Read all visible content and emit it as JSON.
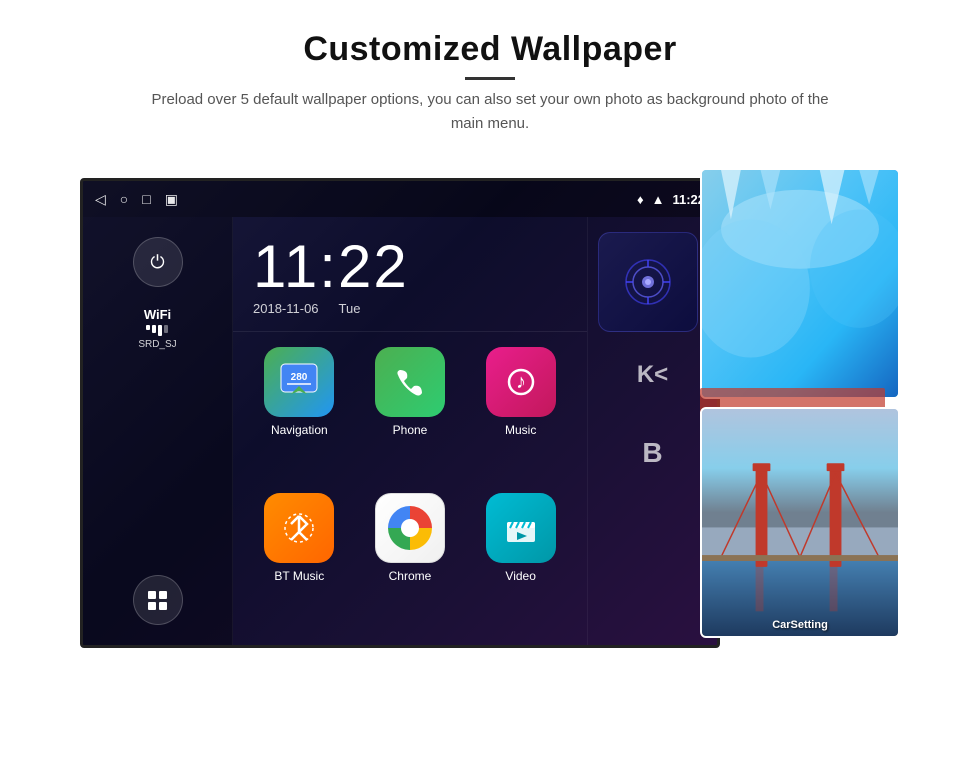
{
  "page": {
    "title": "Customized Wallpaper",
    "title_divider": true,
    "subtitle": "Preload over 5 default wallpaper options, you can also set your own photo as background photo of the main menu."
  },
  "status_bar": {
    "time": "11:22",
    "icons_left": [
      "back",
      "home",
      "recent",
      "screenshot"
    ],
    "icons_right": [
      "location",
      "wifi",
      "time"
    ]
  },
  "clock": {
    "time": "11:22",
    "date": "2018-11-06",
    "day": "Tue"
  },
  "wifi": {
    "label": "WiFi",
    "ssid": "SRD_SJ"
  },
  "apps": [
    {
      "id": "navigation",
      "label": "Navigation",
      "icon_class": "icon-navigation"
    },
    {
      "id": "phone",
      "label": "Phone",
      "icon_class": "icon-phone"
    },
    {
      "id": "music",
      "label": "Music",
      "icon_class": "icon-music"
    },
    {
      "id": "btmusic",
      "label": "BT Music",
      "icon_class": "icon-btmusic"
    },
    {
      "id": "chrome",
      "label": "Chrome",
      "icon_class": "icon-chrome"
    },
    {
      "id": "video",
      "label": "Video",
      "icon_class": "icon-video"
    }
  ],
  "wallpaper_labels": {
    "carsetting": "CarSetting"
  },
  "sidebar_buttons": {
    "power": "⏻",
    "wifi_label": "WiFi",
    "apps_label": "Apps"
  }
}
